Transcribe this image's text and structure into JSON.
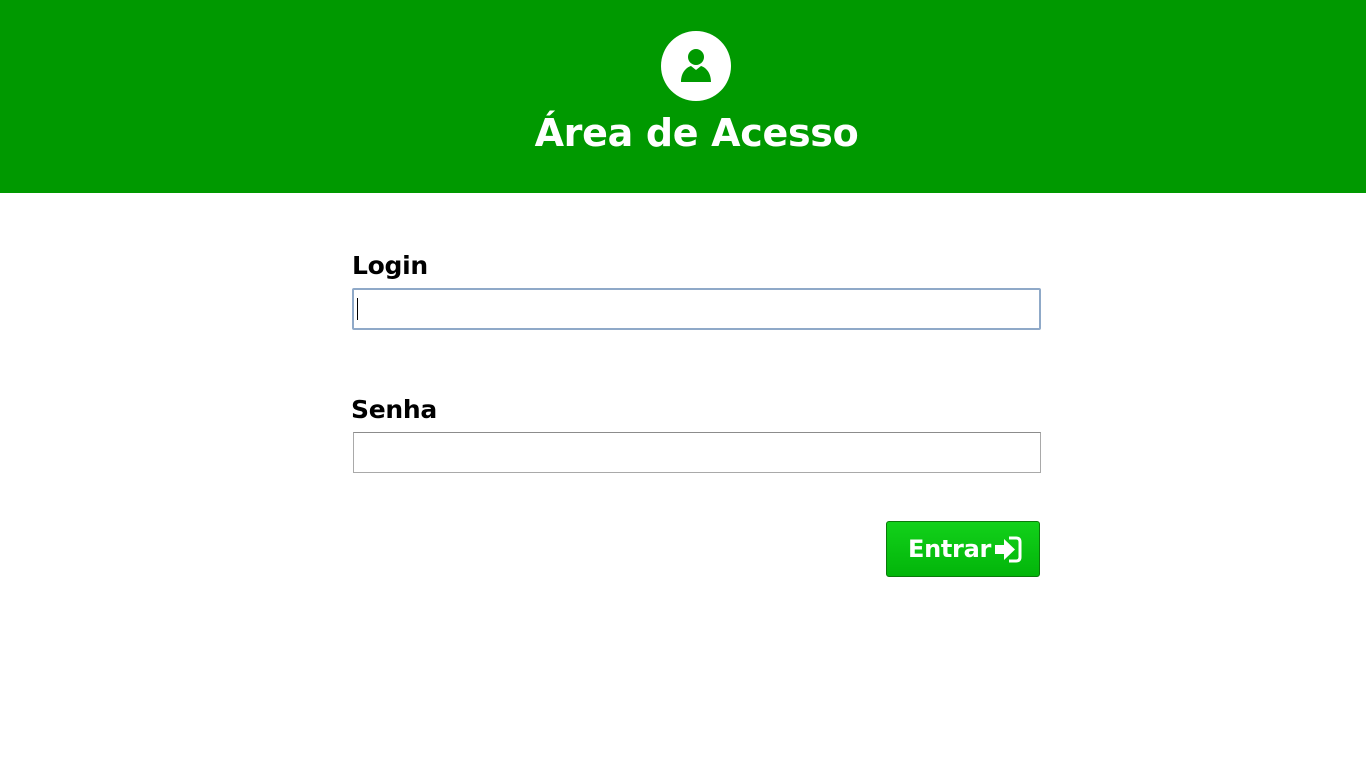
{
  "header": {
    "title": "Área de Acesso",
    "icon": "user-icon",
    "background_color": "#009900"
  },
  "form": {
    "login_label": "Login",
    "login_value": "",
    "senha_label": "Senha",
    "senha_value": "",
    "submit_label": "Entrar",
    "submit_icon": "sign-in-icon",
    "submit_color": "#0cc514"
  }
}
